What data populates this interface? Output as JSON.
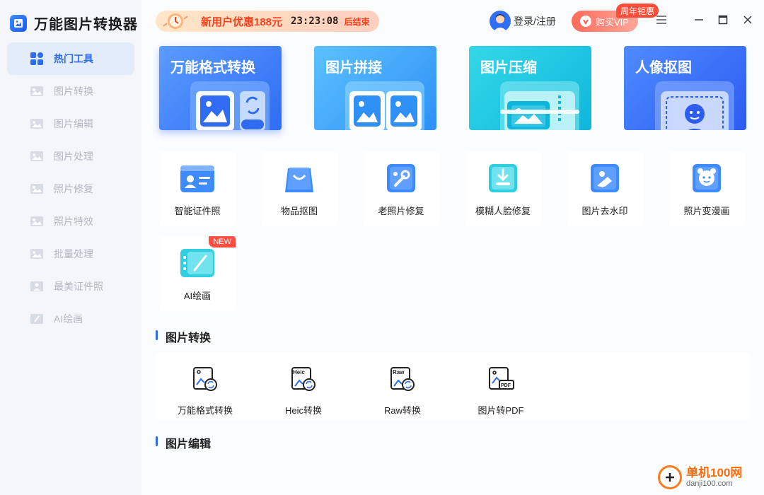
{
  "app": {
    "title": "万能图片转换器"
  },
  "sidebar": {
    "items": [
      {
        "label": "热门工具",
        "active": true
      },
      {
        "label": "图片转换"
      },
      {
        "label": "图片编辑"
      },
      {
        "label": "图片处理"
      },
      {
        "label": "照片修复"
      },
      {
        "label": "照片特效"
      },
      {
        "label": "批量处理"
      },
      {
        "label": "最美证件照"
      },
      {
        "label": "AI绘画"
      }
    ]
  },
  "header": {
    "promo_text": "新用户优惠188元",
    "promo_timer": "23:23:08",
    "promo_end": "后结束",
    "login_label": "登录/注册",
    "vip_label": "购买VIP",
    "vip_badge": "周年钜惠"
  },
  "features": [
    {
      "title": "万能格式转换",
      "color_from": "#5a9cff",
      "color_to": "#2f6cf3"
    },
    {
      "title": "图片拼接",
      "color_from": "#5bc2ff",
      "color_to": "#2e8ff5"
    },
    {
      "title": "图片压缩",
      "color_from": "#34d8e8",
      "color_to": "#0fb6dc"
    },
    {
      "title": "人像抠图",
      "color_from": "#4f8bff",
      "color_to": "#2c5cf0"
    }
  ],
  "tools": [
    {
      "label": "智能证件照"
    },
    {
      "label": "物品抠图"
    },
    {
      "label": "老照片修复"
    },
    {
      "label": "模糊人脸修复"
    },
    {
      "label": "图片去水印"
    },
    {
      "label": "照片变漫画"
    },
    {
      "label": "AI绘画",
      "badge": "NEW"
    }
  ],
  "sections": {
    "convert_title": "图片转换",
    "edit_title": "图片编辑"
  },
  "convert_items": [
    {
      "label": "万能格式转换",
      "tag": ""
    },
    {
      "label": "Heic转换",
      "tag": "Heic"
    },
    {
      "label": "Raw转换",
      "tag": "Raw"
    },
    {
      "label": "图片转PDF",
      "tag": "PDF"
    }
  ],
  "watermark": {
    "name": "单机100网",
    "url": "danji100.com"
  }
}
